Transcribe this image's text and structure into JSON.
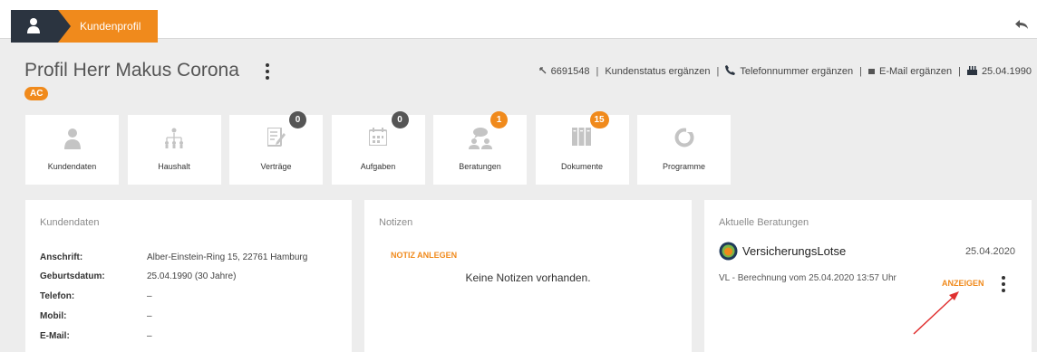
{
  "topbar": {
    "tab_label": "Kundenprofil",
    "user_icon": "user-icon",
    "back_icon": "reply-arrow-icon"
  },
  "header": {
    "title": "Profil Herr Makus Corona",
    "badge": "AC",
    "meta": {
      "id": "6691548",
      "status": "Kundenstatus ergänzen",
      "phone": "Telefonnummer ergänzen",
      "email": "E-Mail ergänzen",
      "birthday": "25.04.1990"
    }
  },
  "tiles": [
    {
      "label": "Kundendaten",
      "icon": "person-icon"
    },
    {
      "label": "Haushalt",
      "icon": "household-tree-icon"
    },
    {
      "label": "Verträge",
      "icon": "contract-edit-icon",
      "count": "0"
    },
    {
      "label": "Aufgaben",
      "icon": "calendar-icon",
      "count": "0"
    },
    {
      "label": "Beratungen",
      "icon": "consultation-icon",
      "count": "1"
    },
    {
      "label": "Dokumente",
      "icon": "documents-icon",
      "count": "15"
    },
    {
      "label": "Programme",
      "icon": "programme-ring-icon"
    }
  ],
  "kundendaten": {
    "title": "Kundendaten",
    "rows": [
      {
        "key": "Anschrift:",
        "value": "Alber-Einstein-Ring 15, 22761 Hamburg"
      },
      {
        "key": "Geburtsdatum:",
        "value": "25.04.1990 (30 Jahre)"
      },
      {
        "key": "Telefon:",
        "value": "–"
      },
      {
        "key": "Mobil:",
        "value": "–"
      },
      {
        "key": "E-Mail:",
        "value": "–"
      }
    ]
  },
  "notizen": {
    "title": "Notizen",
    "add_label": "NOTIZ ANLEGEN",
    "empty_text": "Keine Notizen vorhanden."
  },
  "beratungen": {
    "title": "Aktuelle Beratungen",
    "item_name": "VersicherungsLotse",
    "item_date": "25.04.2020",
    "item_desc": "VL - Berechnung vom 25.04.2020 13:57 Uhr",
    "show_label": "ANZEIGEN"
  },
  "colors": {
    "accent": "#f08a1c",
    "dark": "#2b3440",
    "background": "#ededed",
    "annotation_arrow": "#e03030"
  }
}
